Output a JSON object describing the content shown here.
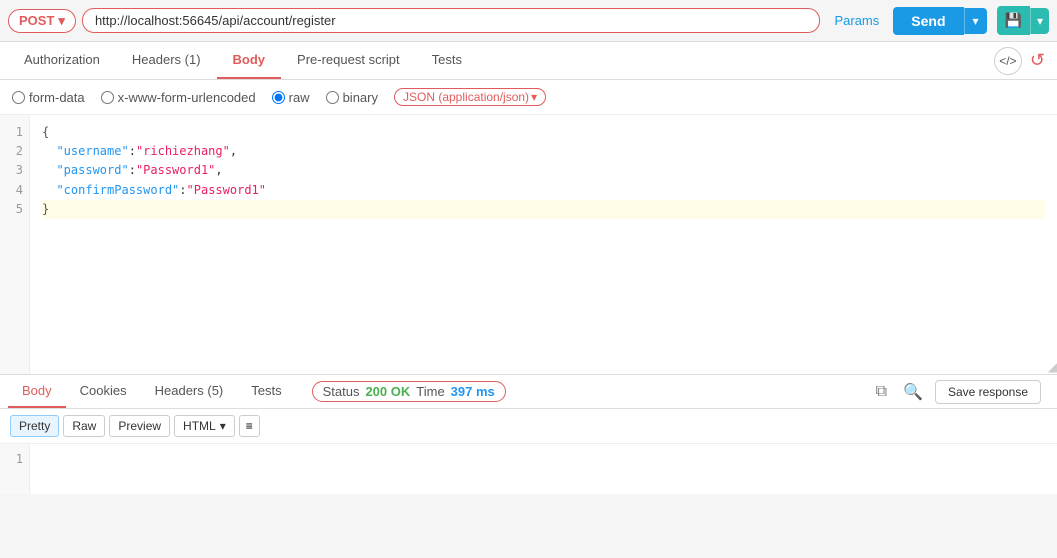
{
  "topbar": {
    "method": "POST",
    "method_dropdown_icon": "▾",
    "url": "http://localhost:56645/api/account/register",
    "params_label": "Params",
    "send_label": "Send",
    "send_dropdown_icon": "▾",
    "save_icon": "💾",
    "save_dropdown_icon": "▾"
  },
  "tabs": [
    {
      "label": "Authorization",
      "active": false
    },
    {
      "label": "Headers (1)",
      "active": false
    },
    {
      "label": "Body",
      "active": true
    },
    {
      "label": "Pre-request script",
      "active": false
    },
    {
      "label": "Tests",
      "active": false
    }
  ],
  "toolbar_right": {
    "code_icon": "</>",
    "refresh_icon": "↺"
  },
  "body_options": {
    "options": [
      {
        "label": "form-data",
        "name": "body-type",
        "value": "form-data",
        "checked": false
      },
      {
        "label": "x-www-form-urlencoded",
        "name": "body-type",
        "value": "urlencoded",
        "checked": false
      },
      {
        "label": "raw",
        "name": "body-type",
        "value": "raw",
        "checked": true
      },
      {
        "label": "binary",
        "name": "body-type",
        "value": "binary",
        "checked": false
      }
    ],
    "json_badge_label": "JSON (application/json)",
    "json_badge_icon": "▾"
  },
  "editor": {
    "lines": [
      {
        "num": 1,
        "text": "{",
        "highlighted": false
      },
      {
        "num": 2,
        "text": "  \"username\":\"richiezhang\",",
        "highlighted": false
      },
      {
        "num": 3,
        "text": "  \"password\":\"Password1\",",
        "highlighted": false
      },
      {
        "num": 4,
        "text": "  \"confirmPassword\":\"Password1\"",
        "highlighted": false
      },
      {
        "num": 5,
        "text": "}",
        "highlighted": true
      }
    ]
  },
  "bottom_panel": {
    "tabs": [
      {
        "label": "Body",
        "active": true
      },
      {
        "label": "Cookies",
        "active": false
      },
      {
        "label": "Headers (5)",
        "active": false
      },
      {
        "label": "Tests",
        "active": false
      }
    ],
    "status_label": "Status",
    "status_value": "200 OK",
    "time_label": "Time",
    "time_value": "397 ms",
    "copy_icon": "⧉",
    "search_icon": "🔍",
    "save_response_label": "Save response",
    "format_btns": [
      {
        "label": "Pretty",
        "active": true
      },
      {
        "label": "Raw",
        "active": false
      },
      {
        "label": "Preview",
        "active": false
      }
    ],
    "format_select": "HTML",
    "wrap_icon": "≡",
    "bottom_line_num": 1
  }
}
